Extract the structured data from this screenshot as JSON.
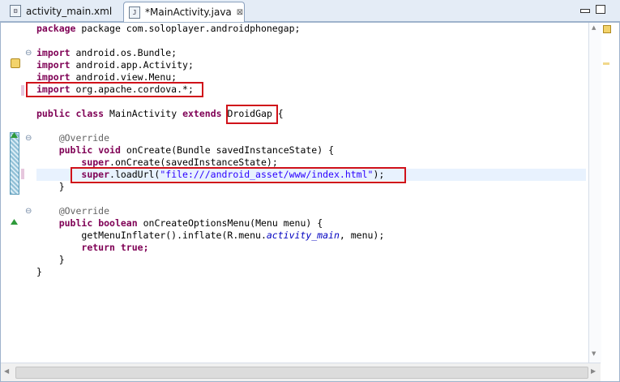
{
  "tabs": [
    {
      "label": "activity_main.xml",
      "active": false,
      "icon": "xml-file-icon"
    },
    {
      "label": "*MainActivity.java",
      "active": true,
      "icon": "java-file-icon",
      "close": "⊠"
    }
  ],
  "code": {
    "line1": "package com.soloplayer.androidphonegap;",
    "imports": [
      "android.os.Bundle;",
      "android.app.Activity;",
      "android.view.Menu;",
      "org.apache.cordova.*;"
    ],
    "class_name": "MainActivity",
    "superclass": "DroidGap",
    "annotation": "@Override",
    "oncreate_sig": "onCreate(Bundle savedInstanceState) {",
    "super_oncreate": "onCreate(savedInstanceState);",
    "loadurl_call": "loadUrl(",
    "loadurl_arg": "\"file:///android_asset/www/index.html\"",
    "loadurl_end": ");",
    "menu_sig": "onCreateOptionsMenu(Menu menu) {",
    "inflate_call": "getMenuInflater().inflate(R.menu.",
    "inflate_field": "activity_main",
    "inflate_end": ", menu);",
    "return_true": "true;"
  },
  "colors": {
    "keyword": "#7f0055",
    "string": "#2a00ff",
    "annotation": "#646464",
    "highlight": "#e8f2fe",
    "callout": "#d0121a"
  }
}
